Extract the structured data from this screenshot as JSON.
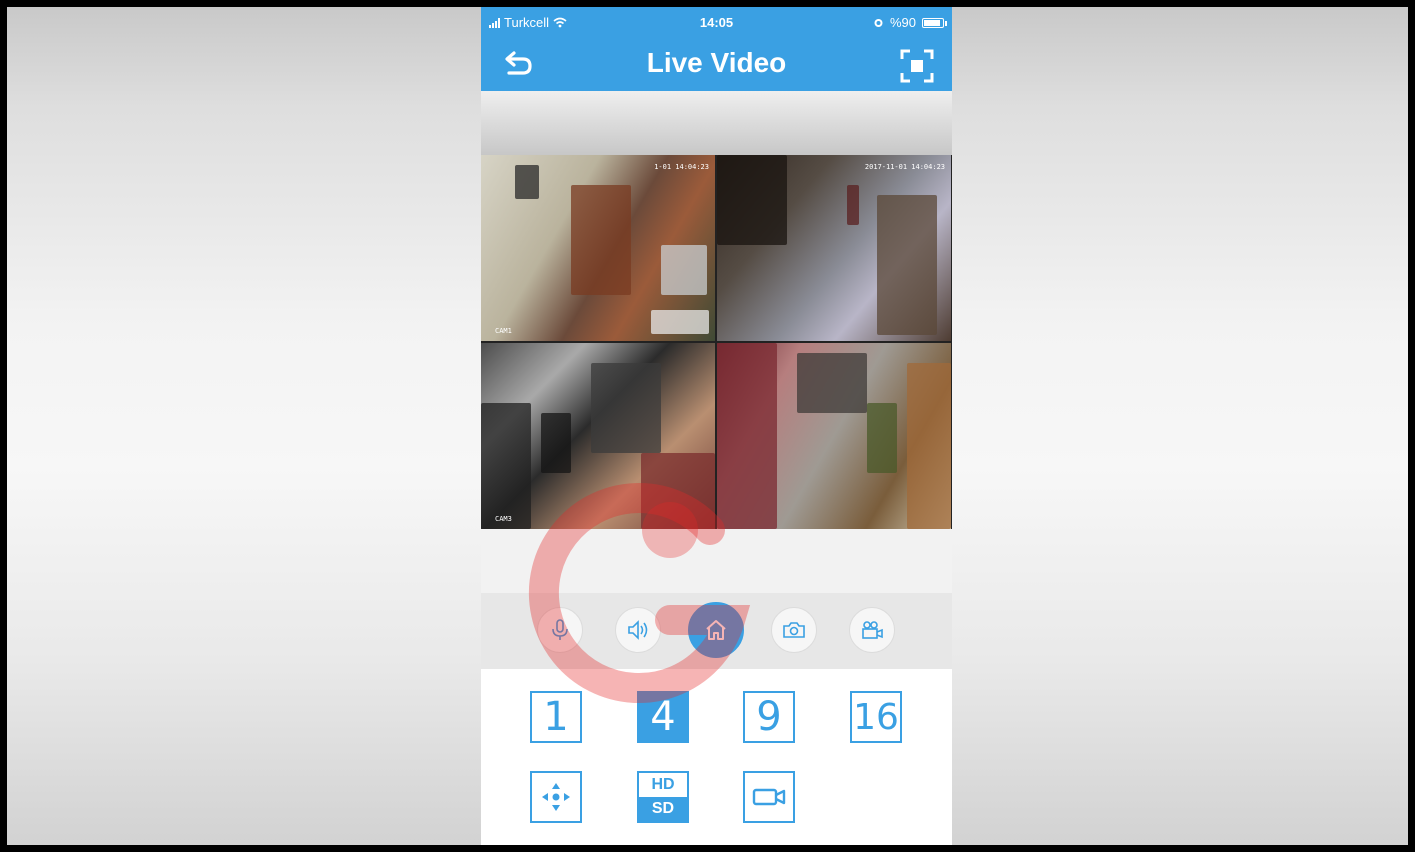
{
  "statusbar": {
    "carrier": "Turkcell",
    "time": "14:05",
    "battery": "%90"
  },
  "navbar": {
    "title": "Live Video"
  },
  "cameras": [
    {
      "timestamp": "1-01 14:04:23",
      "label": "CAM1"
    },
    {
      "timestamp": "2017-11-01 14:04:23",
      "label": ""
    },
    {
      "timestamp": "",
      "label": "CAM3"
    },
    {
      "timestamp": "",
      "label": ""
    }
  ],
  "toolbar": {
    "items": [
      "microphone-icon",
      "speaker-icon",
      "home-icon",
      "camera-icon",
      "video-camera-icon"
    ],
    "active": "home-icon"
  },
  "layouts": {
    "options": [
      "1",
      "4",
      "9",
      "16"
    ],
    "selected": "4"
  },
  "extras": {
    "hd_label": "HD",
    "sd_label": "SD"
  },
  "colors": {
    "accent": "#3aa0e3",
    "watermark": "#e62828"
  }
}
